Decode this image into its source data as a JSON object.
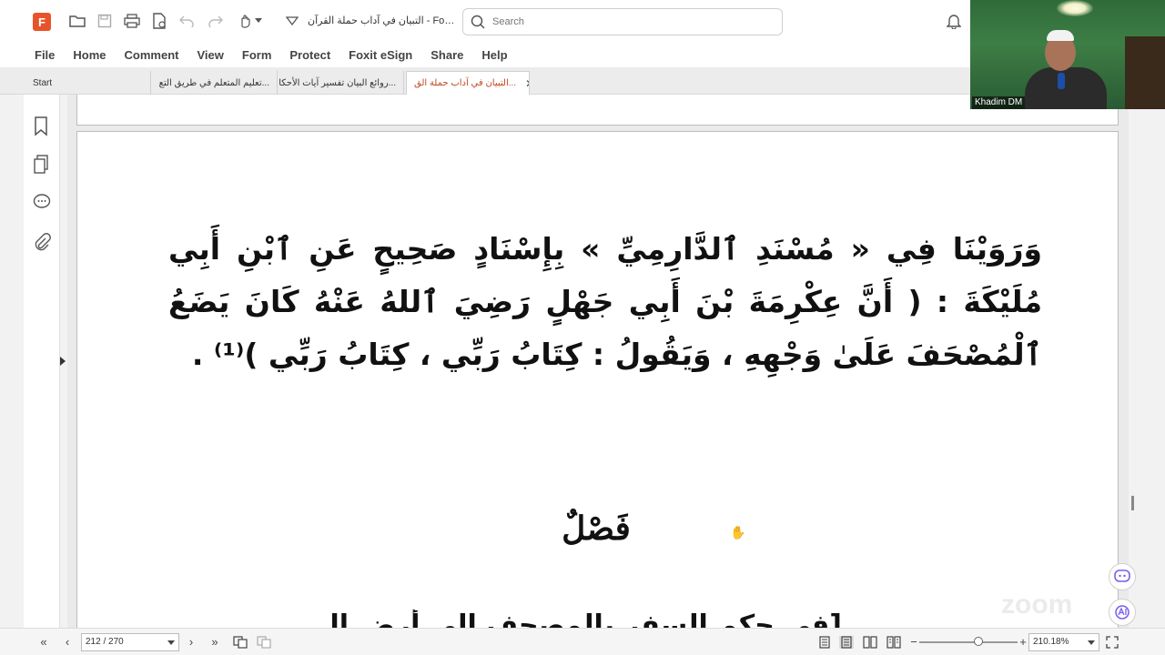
{
  "window": {
    "doc_title": "التبيان في آداب حملة القرآن - Foxit P...",
    "search_placeholder": "Search"
  },
  "menu": [
    "File",
    "Home",
    "Comment",
    "View",
    "Form",
    "Protect",
    "Foxit eSign",
    "Share",
    "Help"
  ],
  "tabs": [
    {
      "label": "Start"
    },
    {
      "label": "...تعليم المتعلم في طريق التع"
    },
    {
      "label": "...روائع البيان تفسير آيات الأحكا"
    },
    {
      "label": "...التبيان في آداب حملة الق",
      "active": true
    }
  ],
  "document": {
    "paragraph": "وَرَوَيْنَا فِي « مُسْنَدِ ٱلدَّارِمِيِّ » بِإِسْنَادٍ صَحِيحٍ عَنِ ٱبْنِ أَبِي مُلَيْكَةَ : ( أَنَّ عِكْرِمَةَ بْنَ أَبِي جَهْلٍ رَضِيَ ٱللهُ عَنْهُ كَانَ يَضَعُ ٱلْمُصْحَفَ عَلَىٰ وَجْهِهِ ، وَيَقُولُ : كِتَابُ رَبِّي ، كِتَابُ رَبِّي )⁽¹⁾ .",
    "section_heading": "فَصْلٌ",
    "cut_line": "[في حكم السفر بالمصحف إلى أرض العدو]"
  },
  "status": {
    "page_field": "212 / 270",
    "zoom_field": "210.18%",
    "zoom_fraction": 0.6
  },
  "video": {
    "participant_name": "Khadim DM"
  },
  "watermark": "zoom",
  "icons": {
    "toolbar": [
      "open-icon",
      "save-icon",
      "print-icon",
      "file-icon",
      "undo-icon",
      "redo-icon",
      "hand-icon",
      "dropdown-icon",
      "bell-icon"
    ],
    "sidebar": [
      "bookmark-icon",
      "pages-icon",
      "comment-icon",
      "attachment-icon"
    ],
    "statusbar": [
      "first-page-icon",
      "prev-page-icon",
      "next-page-icon",
      "last-page-icon",
      "extract-icon",
      "rotate-icon",
      "single-page-icon",
      "continuous-icon",
      "facing-icon",
      "cover-icon",
      "zoom-out-icon",
      "zoom-in-icon",
      "fullscreen-icon"
    ],
    "floating": [
      "chat-assistant-icon",
      "ai-icon"
    ]
  }
}
